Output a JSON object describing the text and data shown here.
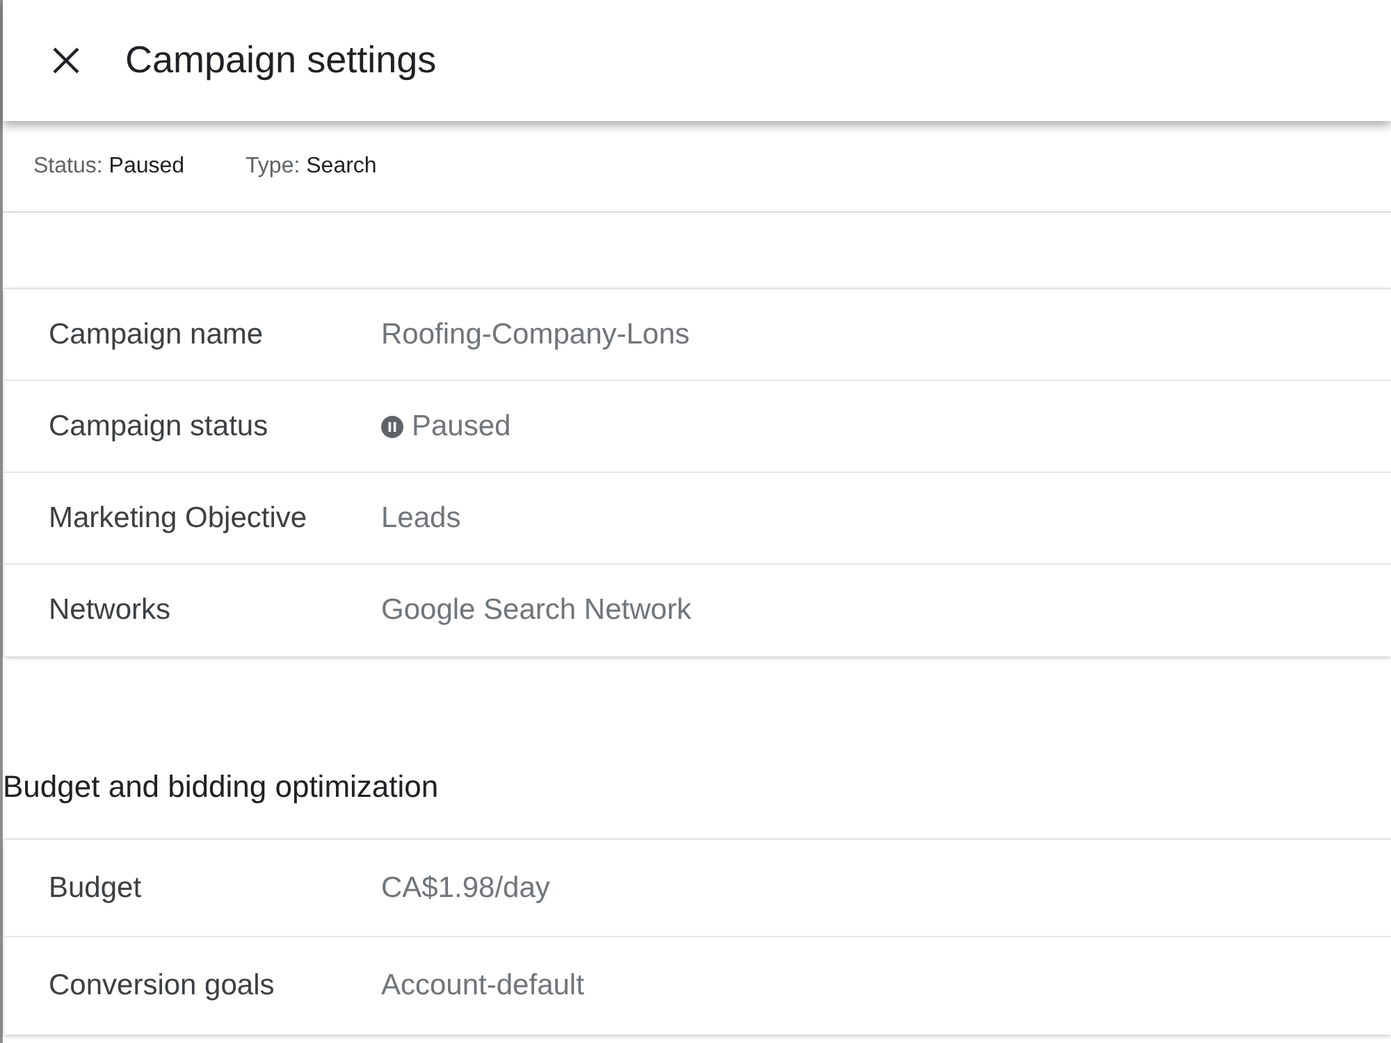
{
  "header": {
    "title": "Campaign settings"
  },
  "summary": [
    {
      "label": "Status:",
      "value": "Paused"
    },
    {
      "label": "Type:",
      "value": "Search"
    }
  ],
  "sections": [
    {
      "rows": [
        {
          "kind": "text",
          "label": "Campaign name",
          "value": "Roofing-Company-Lons"
        },
        {
          "kind": "status",
          "label": "Campaign status",
          "value": "Paused"
        },
        {
          "kind": "text",
          "label": "Marketing Objective",
          "value": "Leads"
        },
        {
          "kind": "text",
          "label": "Networks",
          "value": "Google Search Network"
        }
      ]
    },
    {
      "title": "Budget and bidding optimization",
      "rows": [
        {
          "kind": "text",
          "label": "Budget",
          "value": "CA$1.98/day"
        },
        {
          "kind": "text",
          "label": "Conversion goals",
          "value": "Account-default"
        }
      ]
    }
  ]
}
